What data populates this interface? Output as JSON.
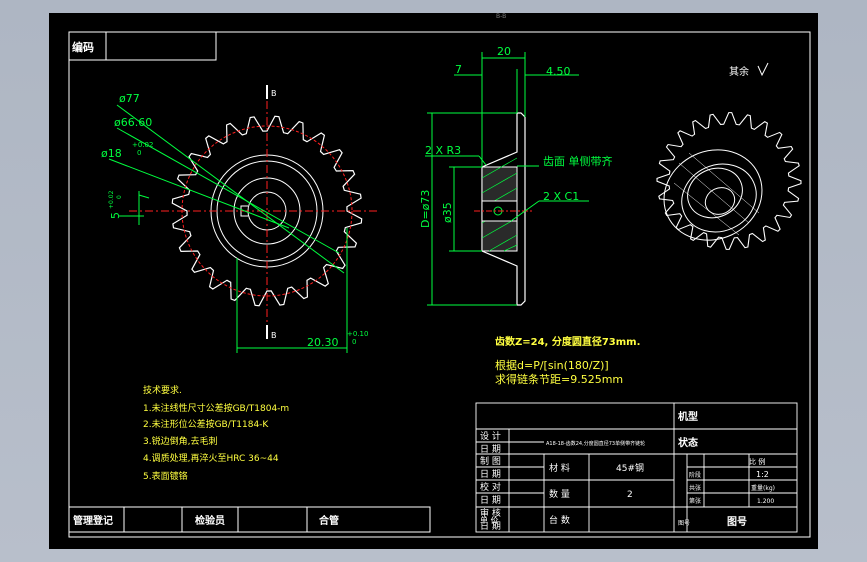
{
  "title_block_top": {
    "code_label": "编码"
  },
  "dimensions": {
    "tip_dia": "ø77",
    "pitch_dia": "ø66.60",
    "bore_dia": "ø18",
    "bore_tol_upper": "+0.02",
    "bore_tol_lower": "0",
    "key_width": "5",
    "key_tol_upper": "+0.02",
    "key_tol_lower": "0",
    "key_depth": "20.30",
    "key_depth_tol_upper": "+0.10",
    "key_depth_tol_lower": "0",
    "width_total": "20",
    "hub_offset": "7",
    "tooth_width": "4.50",
    "fillet": "2 X R3",
    "chamfer": "2 X C1",
    "hub_dia": "D=ø73",
    "inner_dia": "ø35",
    "section_label_b": "B",
    "top_small_label": "B-B"
  },
  "notes": {
    "roughness_rest": "其余",
    "flank_note": "齿面 单侧带齐",
    "teeth_note": "齿数Z=24, 分度圆直径73mm.",
    "formula_note": "根据d=P/[sin(180/Z)]",
    "pitch_note": "求得链条节距=9.525mm"
  },
  "tech_requirements": {
    "heading": "技术要求.",
    "items": [
      "1.未注线性尺寸公差按GB/T1804-m",
      "2.未注形位公差按GB/T1184-K",
      "3.锐边倒角,去毛刺",
      "4.调质处理,再淬火至HRC 36~44",
      "5.表面镀铬"
    ]
  },
  "title_block": {
    "part_name": "A18-18-齿数24,分度圆直径73单侧带齐链轮",
    "machine_label": "机型",
    "status_label": "状态",
    "design": "设 计",
    "date1": "日 期",
    "drawing": "制 图",
    "date2": "日 期",
    "proofread": "校 对",
    "date3": "日 期",
    "review": "审 核",
    "date4": "日 期",
    "unit_price": "单 价",
    "material_label": "材 料",
    "material_value": "45#钢",
    "quantity_label": "数 量",
    "quantity_value": "2",
    "sets_label": "台 数",
    "stage": "阶段",
    "scale_label": "比 例",
    "scale_value": "1:2",
    "weight_label": "重量(kg)",
    "weight_value": "1.200",
    "count_label": "共张",
    "page_label": "第张",
    "series": "序号",
    "drawing_no": "图号",
    "side_label": "图号"
  },
  "bottom_bar": {
    "registry": "管理登记",
    "inspector": "检验员",
    "qualified": "合管"
  },
  "colors": {
    "line_white": "#ffffff",
    "dim_green": "#00ff3f",
    "center_red": "#ff2020",
    "note_yellow": "#ffff40"
  }
}
